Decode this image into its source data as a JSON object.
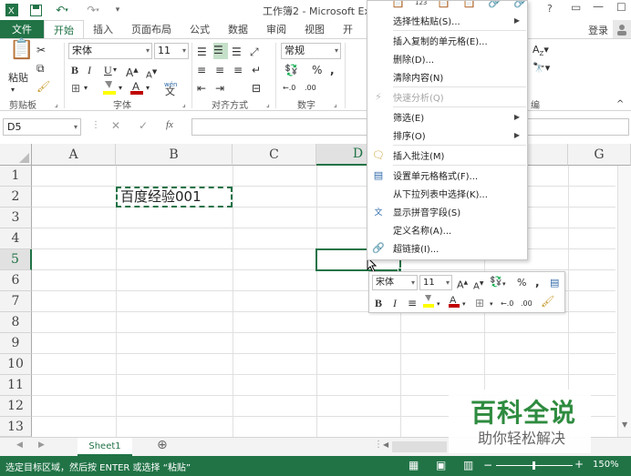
{
  "window": {
    "title": "工作簿2 - Microsoft Excel",
    "help_label": "?",
    "login_label": "登录"
  },
  "tabs": [
    {
      "label": "文件"
    },
    {
      "label": "开始"
    },
    {
      "label": "插入"
    },
    {
      "label": "页面布局"
    },
    {
      "label": "公式"
    },
    {
      "label": "数据"
    },
    {
      "label": "审阅"
    },
    {
      "label": "视图"
    },
    {
      "label": "开"
    }
  ],
  "ribbon": {
    "paste_label": "粘贴",
    "font_name": "宋体",
    "font_size": "11",
    "number_format": "常规",
    "wen_label": "wén",
    "groups": {
      "clipboard": "剪贴板",
      "font": "字体",
      "alignment": "对齐方式",
      "number": "数字",
      "editing": "编"
    }
  },
  "formula_bar": {
    "name_box": "D5",
    "fx_label": "fx",
    "value": ""
  },
  "grid": {
    "columns": [
      "A",
      "B",
      "C",
      "D",
      "",
      "G"
    ],
    "rows": [
      "1",
      "2",
      "3",
      "4",
      "5",
      "6",
      "7",
      "8",
      "9",
      "10",
      "11",
      "12",
      "13"
    ],
    "selected_cell": "D5",
    "cells": {
      "B2": "百度经验001"
    }
  },
  "context_menu": {
    "items": [
      {
        "label": "选择性粘贴(S)...",
        "submenu": true
      },
      {
        "label": "插入复制的单元格(E)..."
      },
      {
        "label": "删除(D)..."
      },
      {
        "label": "清除内容(N)"
      },
      {
        "label": "快速分析(Q)",
        "disabled": true
      },
      {
        "label": "筛选(E)",
        "submenu": true
      },
      {
        "label": "排序(O)",
        "submenu": true
      },
      {
        "label": "插入批注(M)"
      },
      {
        "label": "设置单元格格式(F)..."
      },
      {
        "label": "从下拉列表中选择(K)..."
      },
      {
        "label": "显示拼音字段(S)"
      },
      {
        "label": "定义名称(A)..."
      },
      {
        "label": "超链接(I)..."
      }
    ]
  },
  "mini_toolbar": {
    "font_name": "宋体",
    "font_size": "11",
    "percent_label": "%",
    "comma_label": ","
  },
  "sheets": [
    {
      "name": "Sheet1"
    }
  ],
  "status_bar": {
    "message": "选定目标区域，然后按 ENTER 或选择 “粘贴”",
    "zoom": "150%"
  },
  "watermark": {
    "title": "百科全说",
    "subtitle": "助你轻松解决"
  },
  "colors": {
    "accent": "#217346",
    "status_bar": "#217346",
    "selection_border": "#217346"
  }
}
